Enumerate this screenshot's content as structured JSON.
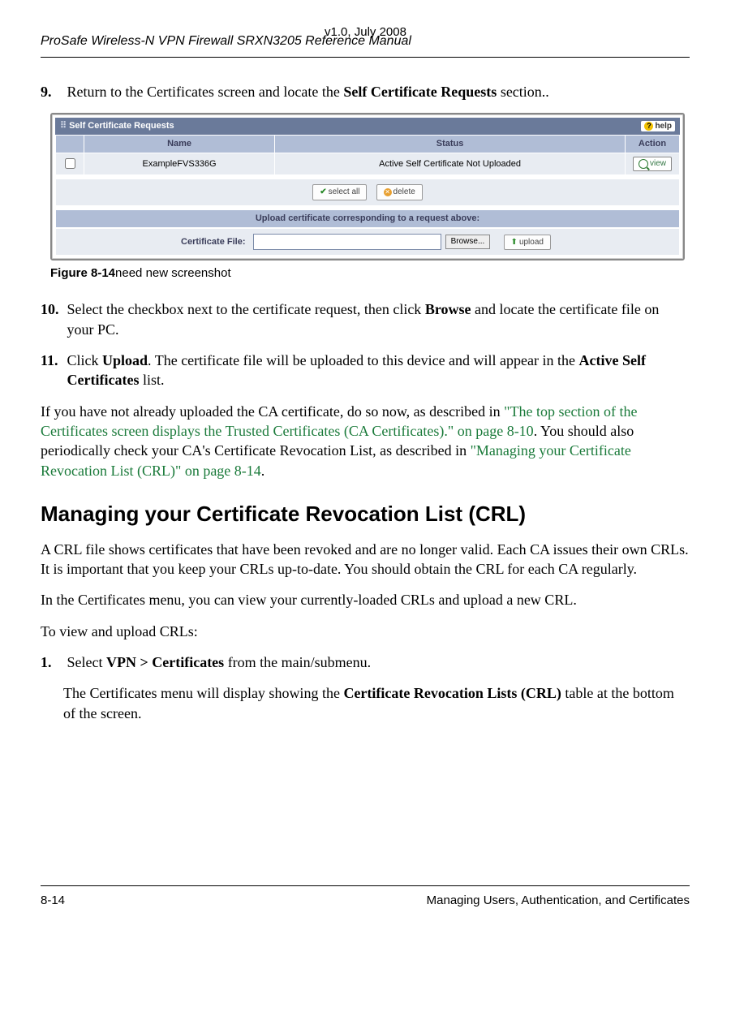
{
  "header": "ProSafe Wireless-N VPN Firewall SRXN3205 Reference Manual",
  "step9_num": "9.",
  "step9_text_a": "Return to the Certificates screen and locate the ",
  "step9_bold": "Self Certificate Requests",
  "step9_text_b": " section..",
  "screenshot": {
    "title": "Self Certificate Requests",
    "help": "help",
    "col_name": "Name",
    "col_status": "Status",
    "col_action": "Action",
    "row_name": "ExampleFVS336G",
    "row_status": "Active Self Certificate Not Uploaded",
    "row_action": "view",
    "btn_selectall": "select all",
    "btn_delete": "delete",
    "subhead": "Upload certificate corresponding to a request above:",
    "file_label": "Certificate File:",
    "browse": "Browse...",
    "btn_upload": "upload"
  },
  "figure_caption_bold": "Figure 8-14",
  "figure_caption_rest": "need new screenshot",
  "step10_num": "10.",
  "step10_a": "Select the checkbox next to the certificate request, then click ",
  "step10_bold1": "Browse",
  "step10_b": " and locate the certificate file on your PC.",
  "step11_num": "11.",
  "step11_a": "Click ",
  "step11_bold1": "Upload",
  "step11_b": ". The certificate file will be uploaded to this device and will appear in the ",
  "step11_bold2": "Active Self Certificates",
  "step11_c": " list.",
  "para_ca_a": "If you have not already uploaded the CA certificate, do so now, as described in ",
  "para_ca_link1": "\"The top section of the Certificates screen displays the Trusted Certificates (CA Certificates).\" on page 8-10",
  "para_ca_b": ". You should also periodically check your CA's Certificate Revocation List, as described in ",
  "para_ca_link2": "\"Managing your Certificate Revocation List (CRL)\" on page 8-14",
  "para_ca_c": ".",
  "section_heading": "Managing your Certificate Revocation List (CRL)",
  "crl_para1": "A CRL file shows certificates that have been revoked and are no longer valid. Each CA issues their own CRLs. It is important that you keep your CRLs up-to-date. You should obtain the CRL for each CA regularly.",
  "crl_para2": "In the Certificates menu, you can view your currently-loaded CRLs and upload a new CRL.",
  "crl_para3": "To view and upload CRLs:",
  "step1_num": "1.",
  "step1_a": "Select ",
  "step1_bold": "VPN > Certificates",
  "step1_b": " from the main/submenu.",
  "step1_sub_a": "The Certificates menu will display showing the ",
  "step1_sub_bold": "Certificate Revocation Lists (CRL)",
  "step1_sub_b": " table at the bottom of the screen.",
  "footer_left": "8-14",
  "footer_right": "Managing Users, Authentication, and Certificates",
  "footer_center": "v1.0, July 2008"
}
